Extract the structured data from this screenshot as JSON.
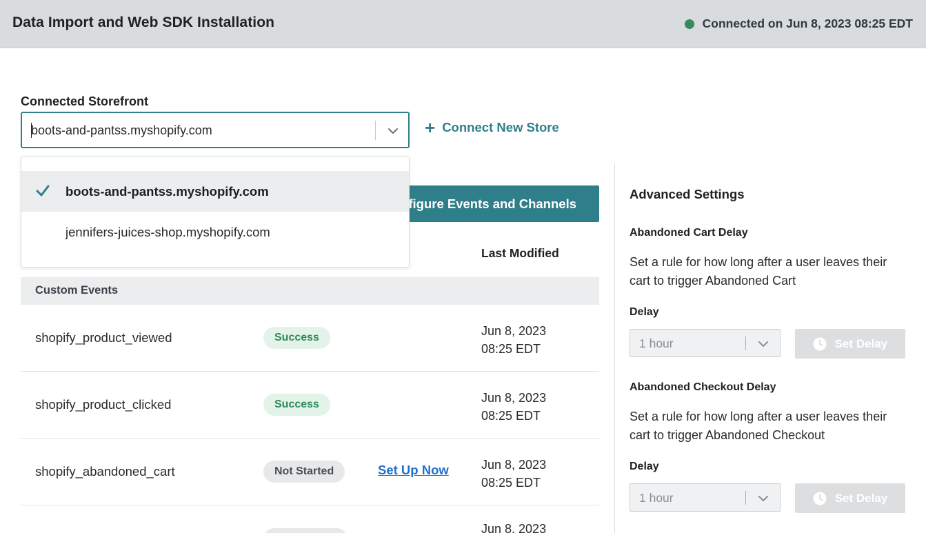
{
  "header": {
    "title": "Data Import and Web SDK Installation",
    "status": "Connected on Jun 8, 2023 08:25 EDT",
    "status_color": "#3a8a5f"
  },
  "storefront": {
    "label": "Connected Storefront",
    "selected": "boots-and-pantss.myshopify.com",
    "connect_new": "Connect New Store",
    "options": [
      "boots-and-pantss.myshopify.com",
      "jennifers-juices-shop.myshopify.com"
    ]
  },
  "main": {
    "configure_button": "Configure Events and Channels",
    "configure_button_visible": "figure Events and Channels",
    "col_last_modified": "Last Modified",
    "group_label": "Custom Events",
    "rows": [
      {
        "name": "shopify_product_viewed",
        "status": "Success",
        "date": "Jun 8, 2023",
        "time": "08:25 EDT"
      },
      {
        "name": "shopify_product_clicked",
        "status": "Success",
        "date": "Jun 8, 2023",
        "time": "08:25 EDT"
      },
      {
        "name": "shopify_abandoned_cart",
        "status": "Not Started",
        "action": "Set Up Now",
        "date": "Jun 8, 2023",
        "time": "08:25 EDT"
      },
      {
        "date": "Jun 8, 2023"
      }
    ]
  },
  "advanced": {
    "title": "Advanced Settings",
    "cart": {
      "title": "Abandoned Cart Delay",
      "desc": "Set a rule for how long after a user leaves their cart to trigger Abandoned Cart",
      "delay_label": "Delay",
      "delay_value": "1 hour",
      "button": "Set Delay"
    },
    "checkout": {
      "title": "Abandoned Checkout Delay",
      "desc": "Set a rule for how long after a user leaves their cart to trigger Abandoned Checkout",
      "delay_label": "Delay",
      "delay_value": "1 hour",
      "button": "Set Delay"
    }
  },
  "colors": {
    "accent": "#2f7f8a",
    "link": "#1f6fd0",
    "success_bg": "#e3f3ea",
    "success_text": "#2e8a59"
  },
  "icons": {
    "status": "status-dot-icon",
    "select": "chevron-down-icon",
    "add": "plus-icon",
    "selected": "check-icon",
    "delay": "clock-icon"
  }
}
